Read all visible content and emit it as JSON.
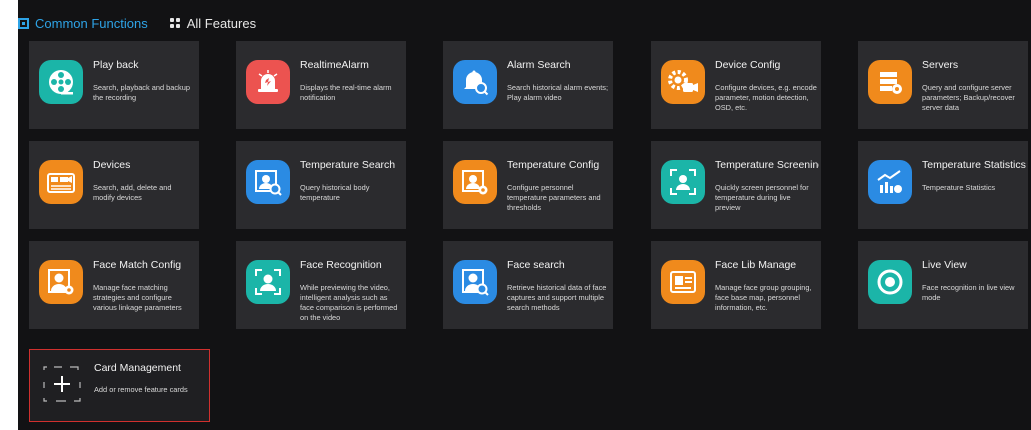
{
  "tabs": [
    {
      "label": "Common Functions",
      "icon": "common-functions-icon"
    },
    {
      "label": "All Features",
      "icon": "grid-icon"
    }
  ],
  "cards": [
    {
      "title": "Play back",
      "desc": "Search, playback and backup the recording",
      "icon": "film-reel-icon",
      "color": "#1bb5a8"
    },
    {
      "title": "RealtimeAlarm",
      "desc": "Displays the real-time alarm notification",
      "icon": "alarm-siren-icon",
      "color": "#ec5350"
    },
    {
      "title": "Alarm Search",
      "desc": "Search historical alarm events; Play alarm video",
      "icon": "bell-search-icon",
      "color": "#2b8be3"
    },
    {
      "title": "Device Config",
      "desc": "Configure devices, e.g. encode parameter, motion detection, OSD, etc.",
      "icon": "camera-gear-icon",
      "color": "#f08a1c"
    },
    {
      "title": "Servers",
      "desc": "Query and configure server parameters; Backup/recover server data",
      "icon": "server-gear-icon",
      "color": "#f08a1c"
    },
    {
      "title": "Devices",
      "desc": "Search, add, delete and modify devices",
      "icon": "device-camera-icon",
      "color": "#f08a1c"
    },
    {
      "title": "Temperature Search",
      "desc": "Query historical body temperature",
      "icon": "temperature-person-search-icon",
      "color": "#2b8be3"
    },
    {
      "title": "Temperature Config",
      "desc": "Configure personnel temperature parameters and thresholds",
      "icon": "temperature-person-gear-icon",
      "color": "#f08a1c"
    },
    {
      "title": "Temperature Screening",
      "desc": "Quickly screen personnel for temperature during live preview",
      "icon": "temperature-person-scan-icon",
      "color": "#1bb5a8"
    },
    {
      "title": "Temperature Statistics",
      "desc": "Temperature Statistics",
      "icon": "bar-chart-icon",
      "color": "#2b8be3"
    },
    {
      "title": "Face Match Config",
      "desc": "Manage face matching strategies and configure various linkage parameters",
      "icon": "face-gear-icon",
      "color": "#f08a1c"
    },
    {
      "title": "Face Recognition",
      "desc": "While previewing the video, intelligent analysis such as face comparison is performed on the video",
      "icon": "face-scan-icon",
      "color": "#1bb5a8"
    },
    {
      "title": "Face search",
      "desc": "Retrieve historical data of face captures and support multiple search methods",
      "icon": "face-search-icon",
      "color": "#2b8be3"
    },
    {
      "title": "Face Lib Manage",
      "desc": "Manage face group grouping, face base map, personnel information, etc.",
      "icon": "id-card-icon",
      "color": "#f08a1c"
    },
    {
      "title": "Live View",
      "desc": "Face recognition in live view mode",
      "icon": "live-view-icon",
      "color": "#1bb5a8"
    },
    {
      "title": "Card Management",
      "desc": "Add or remove feature cards",
      "icon": "add-card-icon",
      "color": ""
    }
  ]
}
